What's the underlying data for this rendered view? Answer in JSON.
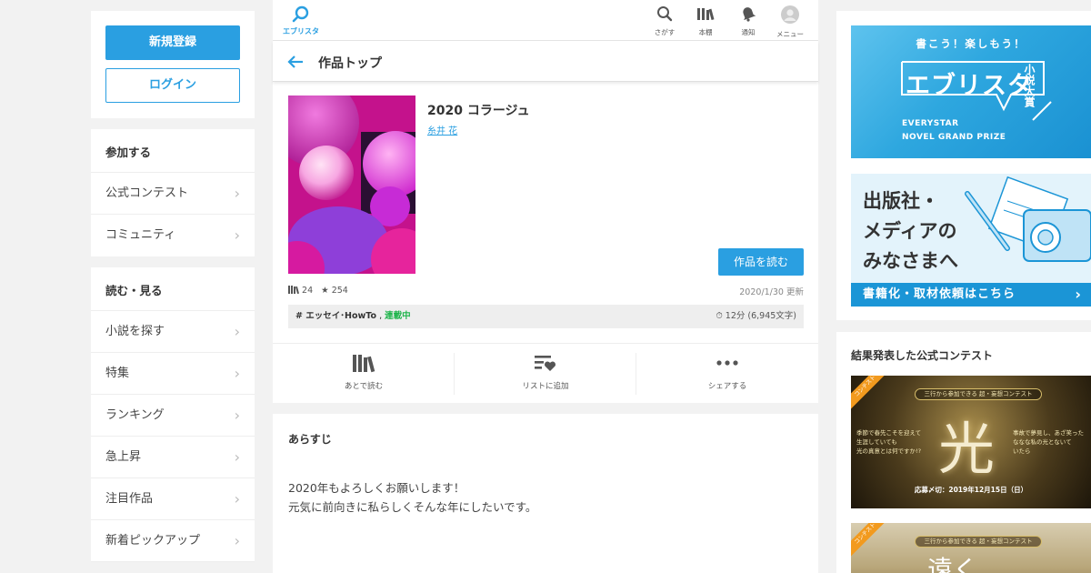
{
  "auth": {
    "register_label": "新規登録",
    "login_label": "ログイン"
  },
  "participate": {
    "heading": "参加する",
    "items": [
      {
        "label": "公式コンテスト"
      },
      {
        "label": "コミュニティ"
      }
    ]
  },
  "read_see": {
    "heading": "読む・見る",
    "items": [
      {
        "label": "小説を探す"
      },
      {
        "label": "特集"
      },
      {
        "label": "ランキング"
      },
      {
        "label": "急上昇"
      },
      {
        "label": "注目作品"
      },
      {
        "label": "新着ピックアップ"
      }
    ]
  },
  "topbar": {
    "brand_label": "エブリスタ",
    "items": [
      {
        "label": "さがす",
        "icon": "search-icon"
      },
      {
        "label": "本棚",
        "icon": "bookshelf-icon"
      },
      {
        "label": "通知",
        "icon": "bell-icon"
      },
      {
        "label": "メニュー",
        "icon": "avatar-icon"
      }
    ]
  },
  "subheader": {
    "title": "作品トップ"
  },
  "work": {
    "title": "2020 コラージュ",
    "author": "糸井 花",
    "read_button": "作品を読む",
    "shelf_count": "24",
    "star_count": "254",
    "updated": "2020/1/30 更新",
    "tag": "# エッセイ･HowTo",
    "tag_sep": ",",
    "status": "連載中",
    "read_time": "12分 (6,945文字)",
    "status_color": "#1db44a",
    "accent_color": "#2a9fe1"
  },
  "actions": [
    {
      "label": "あとで読む",
      "icon": "bookshelf-icon"
    },
    {
      "label": "リストに追加",
      "icon": "list-heart-icon"
    },
    {
      "label": "シェアする",
      "icon": "more-dots-icon"
    }
  ],
  "synopsis": {
    "heading": "あらすじ",
    "line1": "2020年もよろしくお願いします！",
    "line2": "元気に前向きに私らしくそんな年にしたいです。"
  },
  "right": {
    "banner1": {
      "tagline": "書こう！楽しもう！",
      "logo": "エブリスタ",
      "side": "小説大賞",
      "en1": "EVERYSTAR",
      "en2": "NOVEL GRAND PRIZE"
    },
    "banner2": {
      "line1": "出版社・",
      "line2": "メディアの",
      "line3": "みなさまへ",
      "band": "書籍化・取材依頼はこちら"
    },
    "contest_heading": "結果発表した公式コンテスト",
    "contest1": {
      "ribbon": "コンテスト",
      "subtitle": "三行から参加できる 超・妄想コンテスト",
      "kanji": "光",
      "left_text": [
        "季節で春先こそを迎えて",
        "生涯していても",
        "光の真意とは何ですか!?"
      ],
      "right_text": [
        "事故で夢見し、あざ笑った",
        "ななな私の光とないて",
        "いたら"
      ],
      "deadline": "応募〆切：2019年12月15日（日）"
    },
    "contest2": {
      "ribbon": "コンテスト",
      "subtitle": "三行から参加できる 超・妄想コンテスト",
      "kanji": "遠く"
    }
  }
}
